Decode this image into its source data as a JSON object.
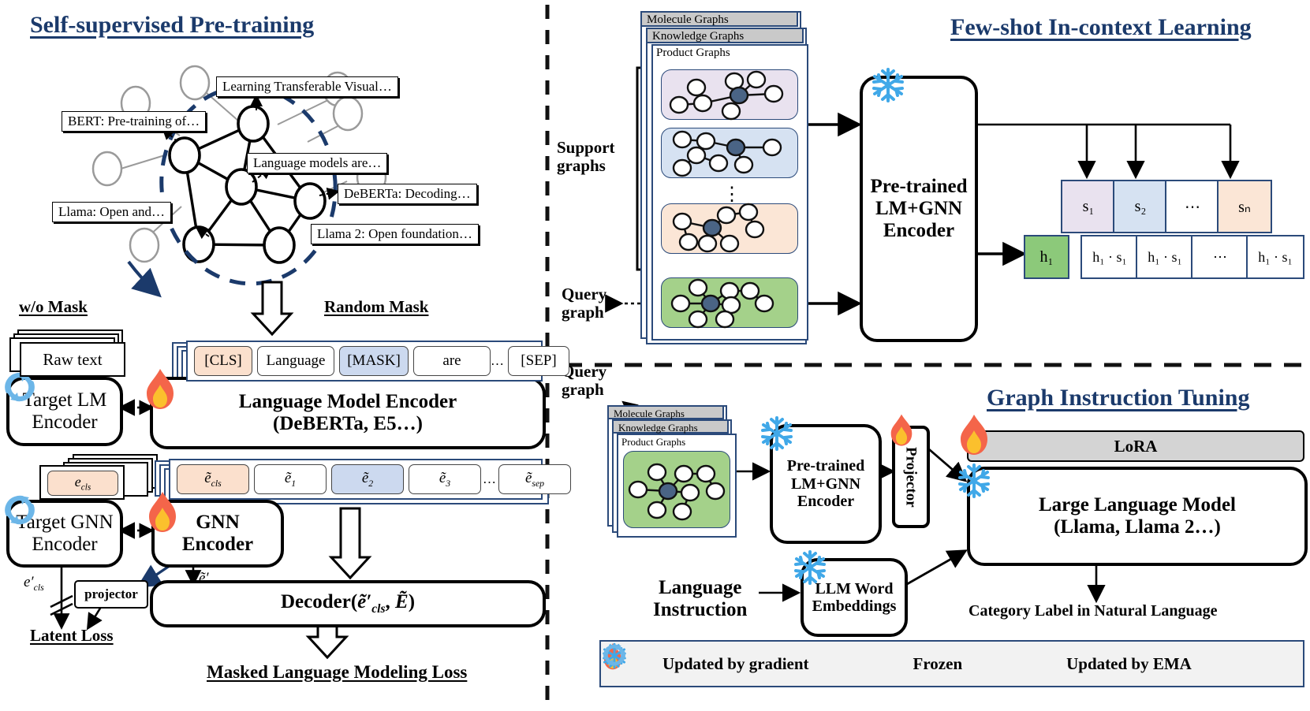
{
  "sections": {
    "pretrain_title": "Self-supervised Pre-training",
    "fewshot_title": "Few-shot In-context Learning",
    "instruction_title": "Graph Instruction Tuning"
  },
  "citation_graph": {
    "papers": [
      "Learning Transferable Visual…",
      "BERT: Pre-training of…",
      "Language models are…",
      "DeBERTa: Decoding…",
      "Llama: Open and…",
      "Llama 2: Open foundation…"
    ]
  },
  "pretrain": {
    "wo_mask_label": "w/o Mask",
    "random_mask_label": "Random Mask",
    "raw_text": "Raw text",
    "target_lm_encoder": "Target LM\nEncoder",
    "lm_encoder_line1": "Language Model Encoder",
    "lm_encoder_line2": "(DeBERTa, E5…)",
    "tokens": [
      "[CLS]",
      "Language",
      "[MASK]",
      "are",
      "[SEP]"
    ],
    "token_ellipsis": "…",
    "embeddings": [
      "ẽ_cls",
      "ẽ₁",
      "ẽ₂",
      "ẽ₃",
      "ẽ_sep"
    ],
    "target_embedding": "e_cls",
    "target_gnn_encoder": "Target GNN\nEncoder",
    "gnn_encoder": "GNN\nEncoder",
    "projector": "projector",
    "decoder": "Decoder(ẽ'_cls, Ẽ)",
    "latent_loss": "Latent Loss",
    "mlm_loss": "Masked Language Modeling Loss",
    "e_cls_prime": "e'_cls",
    "e_tilde_cls_prime": "ẽ'_cls"
  },
  "fewshot": {
    "stack_labels": [
      "Molecule Graphs",
      "Knowledge Graphs",
      "Product Graphs"
    ],
    "support_label": "Support\ngraphs",
    "query_label": "Query\ngraph",
    "encoder": "Pre-trained\nLM+GNN\nEncoder",
    "support_scores": [
      "s₁",
      "s₂",
      "⋯",
      "sₙ"
    ],
    "query_vector": "h₁",
    "products": [
      "h₁ · s₁",
      "h₁ · s₁",
      "⋯",
      "h₁ · s₁"
    ],
    "card_colors": [
      "#e9e2ef",
      "#d6e2f2",
      "#fbe6d6",
      "#a4d18a"
    ]
  },
  "instruction": {
    "stack_labels": [
      "Molecule Graphs",
      "Knowledge Graphs",
      "Product Graphs"
    ],
    "query_label": "Query\ngraph",
    "encoder": "Pre-trained\nLM+GNN\nEncoder",
    "projector": "Projector",
    "lora": "LoRA",
    "llm_line1": "Large Language Model",
    "llm_line2": "(Llama, Llama 2…)",
    "language_instruction": "Language\nInstruction",
    "word_embeddings": "LLM Word\nEmbeddings",
    "output_label": "Category Label in Natural Language",
    "query_card_color": "#a4d18a"
  },
  "legend": {
    "items": [
      {
        "icon": "flame-icon",
        "label": "Updated by gradient"
      },
      {
        "icon": "snowflake-icon",
        "label": "Frozen"
      },
      {
        "icon": "ema-cycle-icon",
        "label": "Updated by EMA"
      }
    ]
  },
  "colors": {
    "title_blue": "#1b3a6b",
    "cls_peach": "#fbe0cd",
    "mask_blue": "#ccd9ef",
    "node_dark": "#4a6485",
    "lora_gray": "#d4d4d4",
    "legend_bg": "#f2f2f2"
  }
}
